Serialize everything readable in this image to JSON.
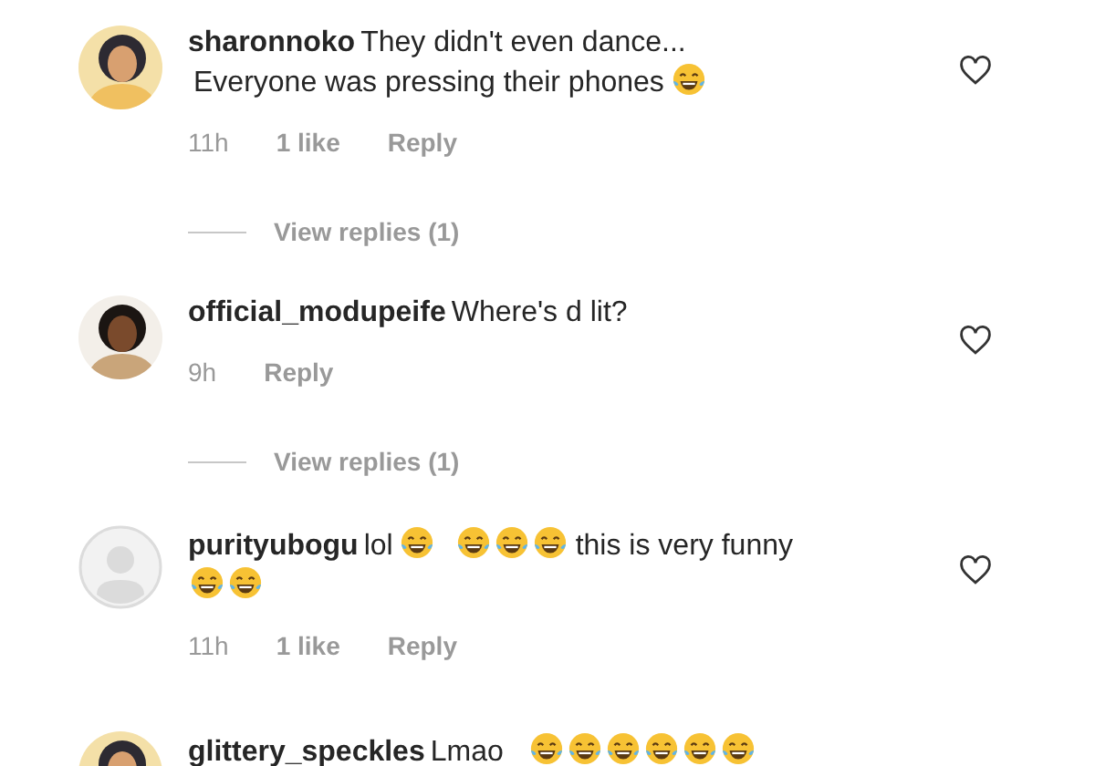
{
  "comments": [
    {
      "username": "sharonnoko",
      "body": [
        {
          "kind": "text",
          "text": "They didn't even dance..."
        },
        {
          "kind": "break"
        },
        {
          "kind": "text",
          "text": "Everyone was pressing their phones"
        },
        {
          "kind": "emoji"
        }
      ],
      "time": "11h",
      "likes": "1 like",
      "reply": "Reply",
      "liked": false,
      "view_replies": "View replies (1)"
    },
    {
      "username": "official_modupeife",
      "body": [
        {
          "kind": "text",
          "text": "Where's d lit?"
        }
      ],
      "time": "9h",
      "reply": "Reply",
      "liked": false,
      "view_replies": "View replies (1)"
    },
    {
      "username": "purityubogu",
      "avatar": {
        "kind": "placeholder"
      },
      "body": [
        {
          "kind": "text",
          "text": "lol"
        },
        {
          "kind": "emoji"
        },
        {
          "kind": "space"
        },
        {
          "kind": "emoji"
        },
        {
          "kind": "emoji"
        },
        {
          "kind": "emoji"
        },
        {
          "kind": "text",
          "text": "this is very funny"
        },
        {
          "kind": "break"
        },
        {
          "kind": "emoji"
        },
        {
          "kind": "emoji"
        }
      ],
      "time": "11h",
      "likes": "1 like",
      "reply": "Reply",
      "liked": false
    },
    {
      "username": "glittery_speckles",
      "body": [
        {
          "kind": "text",
          "text": "Lmao"
        },
        {
          "kind": "space"
        },
        {
          "kind": "emoji"
        },
        {
          "kind": "emoji"
        },
        {
          "kind": "emoji"
        },
        {
          "kind": "emoji"
        },
        {
          "kind": "emoji"
        },
        {
          "kind": "emoji"
        }
      ]
    }
  ]
}
